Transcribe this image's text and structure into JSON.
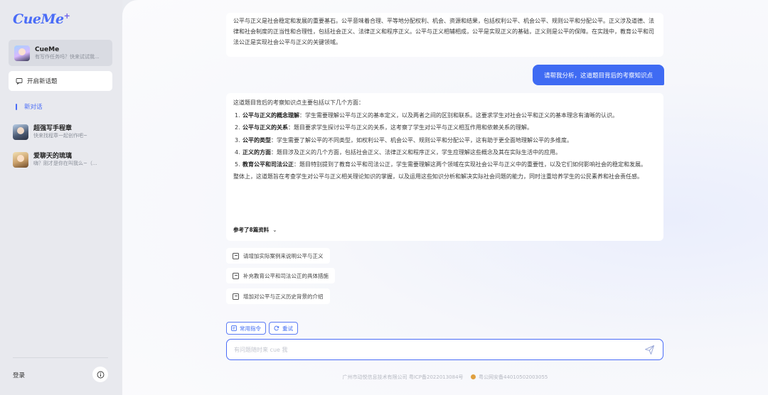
{
  "sidebar": {
    "logo": "CueMe",
    "logo_plus": "+",
    "bots": [
      {
        "name": "CueMe",
        "desc": "有写作任务吗？快来试试我..."
      },
      {
        "name": "超强写手程章",
        "desc": "快来找程章一起创作吧~"
      },
      {
        "name": "爱聊天的琉璃",
        "desc": "嗨？刚才是你在叫我么~（..."
      }
    ],
    "new_topic": "开启新话题",
    "conversation": "新对话",
    "login": "登录"
  },
  "chat": {
    "top_message": "公平与正义是社会稳定和发展的重要基石。公平意味着合理、平等地分配权利、机会、资源和结果，包括权利公平、机会公平、规则公平和分配公平。正义涉及道德、法律和社会制度的正当性和合理性，包括社会正义、法律正义和程序正义。公平与正义相辅相成，公平是实现正义的基础，正义则是公平的保障。在实践中，教育公平和司法公正是实现社会公平与正义的关键领域。",
    "user_message": "请帮我分析，这道题目背后的考察知识点",
    "answer": {
      "intro": "这道题目背后的考察知识点主要包括以下几个方面：",
      "points": [
        {
          "num": "1.",
          "title": "公平与正义的概念理解",
          "text": "：学生需要理解公平与正义的基本定义，以及两者之间的区别和联系。这要求学生对社会公平和正义的基本理念有清晰的认识。"
        },
        {
          "num": "2.",
          "title": "公平与正义的关系",
          "text": "：题目要求学生探讨公平与正义的关系，这考察了学生对公平与正义相互作用和依赖关系的理解。"
        },
        {
          "num": "3.",
          "title": "公平的类型",
          "text": "：学生需要了解公平的不同类型，如权利公平、机会公平、规则公平和分配公平，这有助于更全面地理解公平的多维度。"
        },
        {
          "num": "4.",
          "title": "正义的方面",
          "text": "：题目涉及正义的几个方面，包括社会正义、法律正义和程序正义，学生应理解这些概念及其在实际生活中的应用。"
        },
        {
          "num": "5.",
          "title": "教育公平和司法公正",
          "text": "：题目特别提到了教育公平和司法公正，学生需要理解这两个领域在实现社会公平与正义中的重要性，以及它们如何影响社会的稳定和发展。"
        }
      ],
      "summary": "整体上，这道题旨在考查学生对公平与正义相关理论知识的掌握，以及运用这些知识分析和解决实际社会问题的能力，同时注重培养学生的公民素养和社会责任感。",
      "refs": "参考了8篇资料",
      "refs_chevron": "⌄"
    },
    "suggestions": [
      "请增加实际案例来说明公平与正义",
      "补充教育公平和司法公正的具体措施",
      "增加对公平与正义历史背景的介绍"
    ],
    "chips": {
      "commands": "常用指令",
      "retry": "重试"
    },
    "input_placeholder": "有问题随时来 cue 我",
    "footer": {
      "company": "广州市动悦信息技术有限公司 粤ICP备2022013084号",
      "police": "粤公网安备44010502003055"
    }
  },
  "colors": {
    "accent": "#3f6bf3",
    "sidebar_bg": "#e8e9ee"
  },
  "icons": [
    "new-chat-icon",
    "info-icon",
    "suggestion-icon",
    "command-icon",
    "retry-icon",
    "send-icon",
    "chevron-down-icon"
  ]
}
